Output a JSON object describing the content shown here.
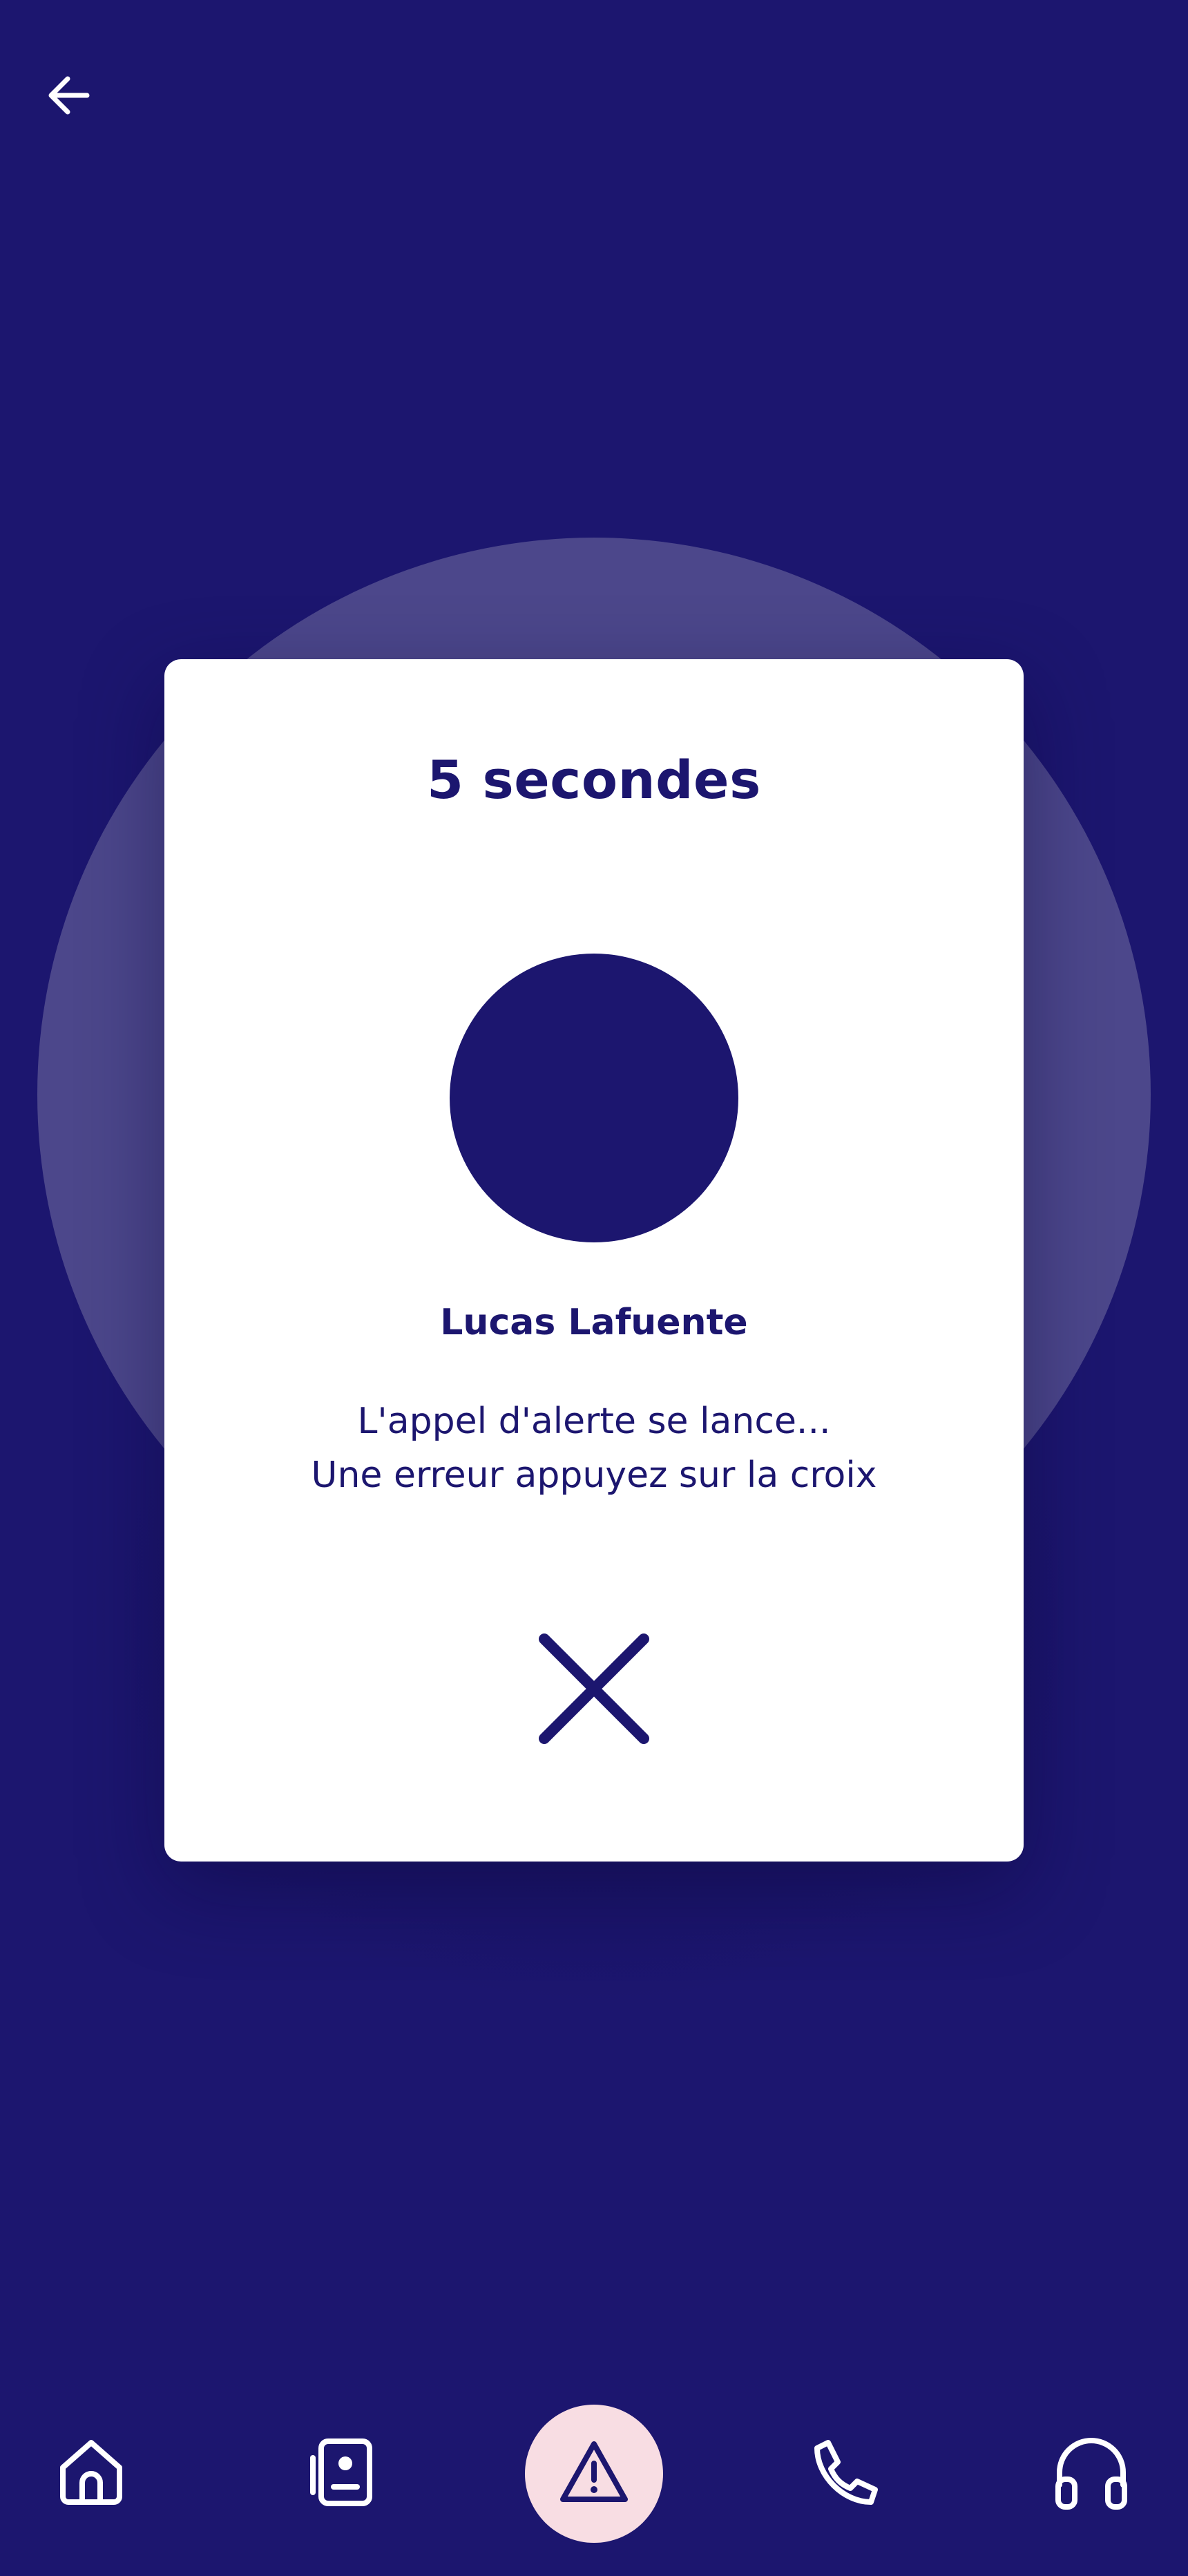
{
  "header": {
    "back_icon": "arrow-left-icon"
  },
  "dialog": {
    "countdown": "5 secondes",
    "contact_name": "Lucas Lafuente",
    "message_line_1": "L'appel d'alerte se lance...",
    "message_line_2": "Une erreur appuyez sur la croix",
    "cancel_icon": "close-icon"
  },
  "bottom_nav": {
    "items": [
      {
        "icon": "home-icon",
        "selected": false
      },
      {
        "icon": "contact-card-icon",
        "selected": false
      },
      {
        "icon": "warning-icon",
        "selected": true
      },
      {
        "icon": "phone-icon",
        "selected": false
      },
      {
        "icon": "headphones-icon",
        "selected": false
      }
    ]
  },
  "colors": {
    "background": "#1c166f",
    "halo": "#4c478b",
    "card": "#ffffff",
    "primary": "#1c166f",
    "alert_button_bg": "#f8dde3"
  }
}
